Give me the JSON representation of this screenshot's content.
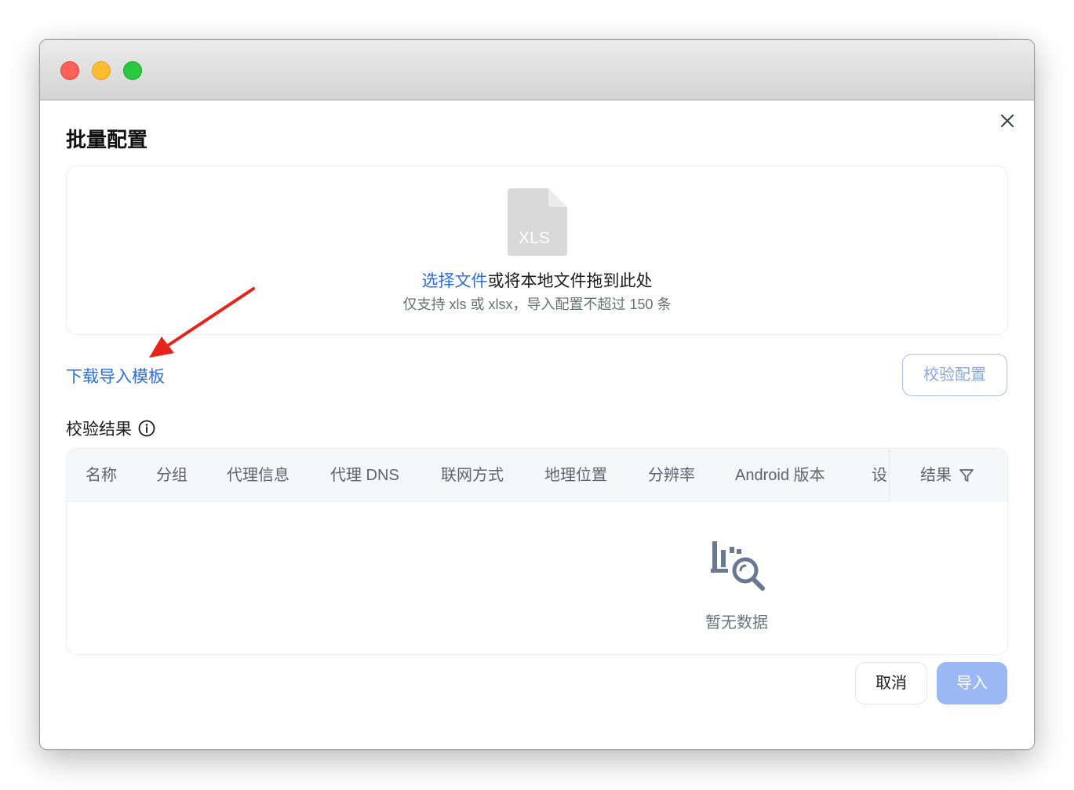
{
  "dialog": {
    "title": "批量配置"
  },
  "dropzone": {
    "file_icon_label": "XLS",
    "select_link": "选择文件",
    "drag_text": "或将本地文件拖到此处",
    "hint": "仅支持 xls 或 xlsx，导入配置不超过 150 条"
  },
  "download_template": "下载导入模板",
  "verify_button": "校验配置",
  "result_label": "校验结果",
  "table": {
    "columns": [
      "名称",
      "分组",
      "代理信息",
      "代理 DNS",
      "联网方式",
      "地理位置",
      "分辨率",
      "Android 版本",
      "设"
    ],
    "fixed_column": "结果",
    "empty_text": "暂无数据"
  },
  "footer": {
    "cancel": "取消",
    "import": "导入"
  },
  "colors": {
    "accent": "#2f6ddb",
    "import_disabled": "#9ab8f3",
    "annotation_arrow": "#e8231c"
  },
  "icons": {
    "close": "close-icon",
    "file": "xls-file-icon",
    "info": "info-icon",
    "filter": "filter-icon",
    "empty": "no-data-search-icon"
  }
}
